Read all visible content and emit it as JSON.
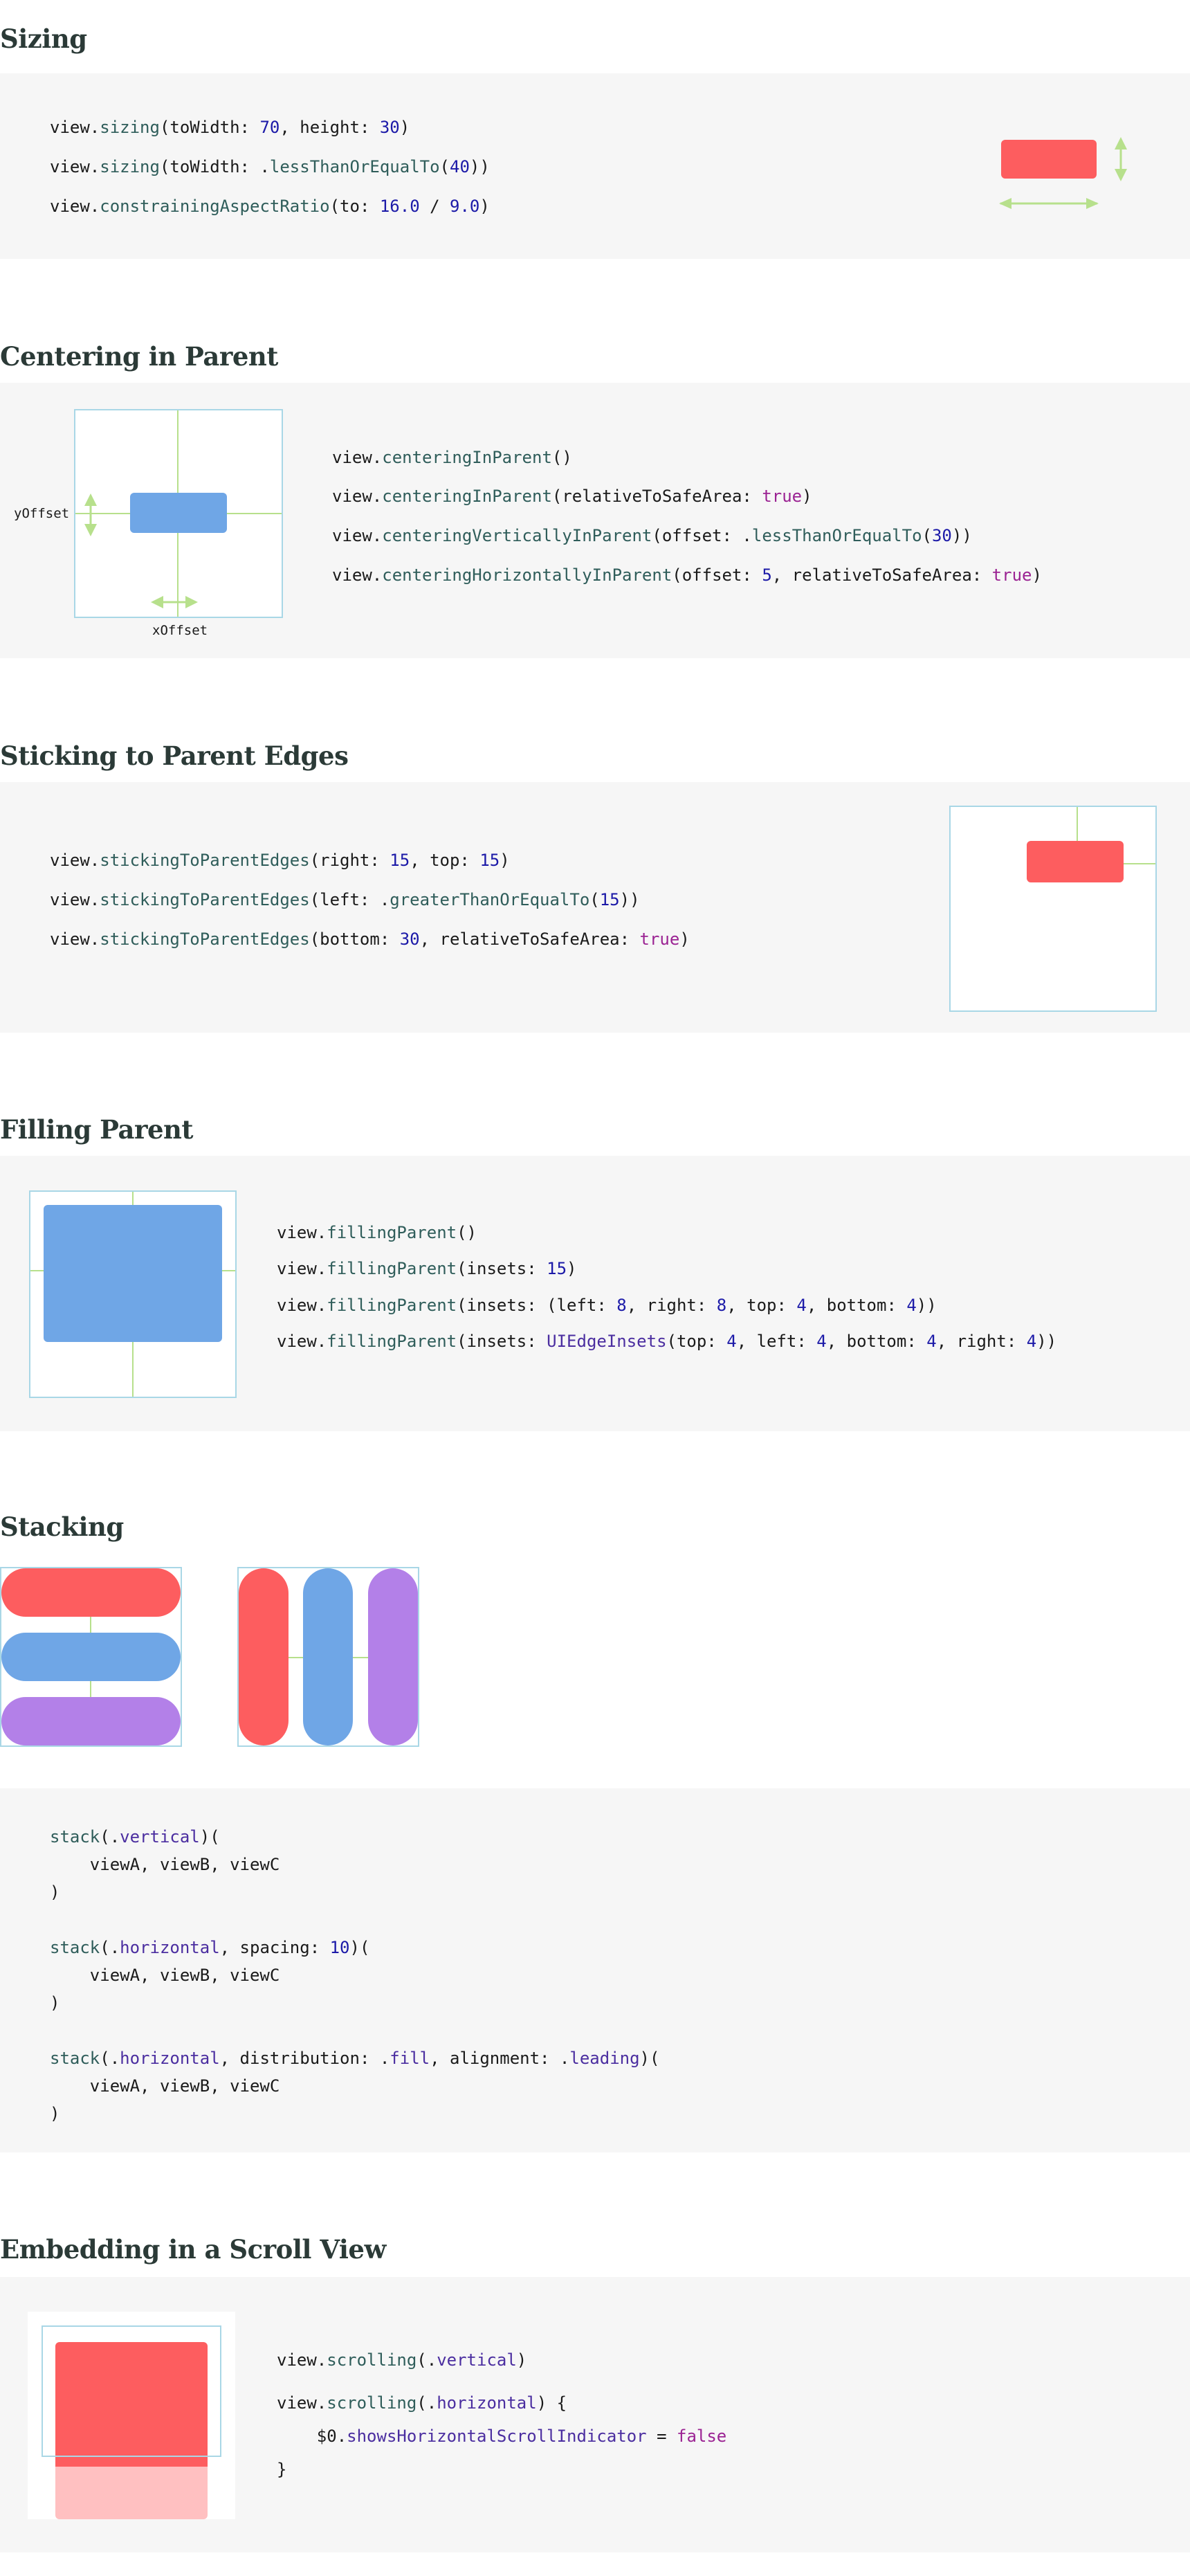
{
  "sections": {
    "sizing": {
      "title": "Sizing"
    },
    "centering": {
      "title": "Centering in Parent",
      "y_offset_label": "yOffset",
      "x_offset_label": "xOffset"
    },
    "sticking": {
      "title": "Sticking to Parent Edges"
    },
    "filling": {
      "title": "Filling Parent"
    },
    "stacking": {
      "title": "Stacking"
    },
    "scroll": {
      "title": "Embedding in a Scroll View"
    }
  },
  "code": {
    "sizing": [
      [
        [
          "view.",
          ""
        ],
        [
          "sizing",
          "t"
        ],
        [
          "(toWidth: ",
          ""
        ],
        [
          "70",
          "n"
        ],
        [
          ", height: ",
          ""
        ],
        [
          "30",
          "n"
        ],
        [
          ")",
          ""
        ]
      ],
      [
        [
          "view.",
          ""
        ],
        [
          "sizing",
          "t"
        ],
        [
          "(toWidth: .",
          ""
        ],
        [
          "lessThanOrEqualTo",
          "t"
        ],
        [
          "(",
          ""
        ],
        [
          "40",
          "n"
        ],
        [
          "))",
          ""
        ]
      ],
      [
        [
          "view.",
          ""
        ],
        [
          "constrainingAspectRatio",
          "t"
        ],
        [
          "(to: ",
          ""
        ],
        [
          "16.0",
          "n"
        ],
        [
          " / ",
          ""
        ],
        [
          "9.0",
          "n"
        ],
        [
          ")",
          ""
        ]
      ]
    ],
    "centering": [
      [
        [
          "view.",
          ""
        ],
        [
          "centeringInParent",
          "t"
        ],
        [
          "()",
          ""
        ]
      ],
      [
        [
          "view.",
          ""
        ],
        [
          "centeringInParent",
          "t"
        ],
        [
          "(relativeToSafeArea: ",
          ""
        ],
        [
          "true",
          "k"
        ],
        [
          ")",
          ""
        ]
      ],
      [
        [
          "view.",
          ""
        ],
        [
          "centeringVerticallyInParent",
          "t"
        ],
        [
          "(offset: .",
          ""
        ],
        [
          "lessThanOrEqualTo",
          "t"
        ],
        [
          "(",
          ""
        ],
        [
          "30",
          "n"
        ],
        [
          "))",
          ""
        ]
      ],
      [
        [
          "view.",
          ""
        ],
        [
          "centeringHorizontallyInParent",
          "t"
        ],
        [
          "(offset: ",
          ""
        ],
        [
          "5",
          "n"
        ],
        [
          ", relativeToSafeArea: ",
          ""
        ],
        [
          "true",
          "k"
        ],
        [
          ")",
          ""
        ]
      ]
    ],
    "sticking": [
      [
        [
          "view.",
          ""
        ],
        [
          "stickingToParentEdges",
          "t"
        ],
        [
          "(right: ",
          ""
        ],
        [
          "15",
          "n"
        ],
        [
          ", top: ",
          ""
        ],
        [
          "15",
          "n"
        ],
        [
          ")",
          ""
        ]
      ],
      [
        [
          "view.",
          ""
        ],
        [
          "stickingToParentEdges",
          "t"
        ],
        [
          "(left: .",
          ""
        ],
        [
          "greaterThanOrEqualTo",
          "t"
        ],
        [
          "(",
          ""
        ],
        [
          "15",
          "n"
        ],
        [
          "))",
          ""
        ]
      ],
      [
        [
          "view.",
          ""
        ],
        [
          "stickingToParentEdges",
          "t"
        ],
        [
          "(bottom: ",
          ""
        ],
        [
          "30",
          "n"
        ],
        [
          ", relativeToSafeArea: ",
          ""
        ],
        [
          "true",
          "k"
        ],
        [
          ")",
          ""
        ]
      ]
    ],
    "filling": [
      [
        [
          "view.",
          ""
        ],
        [
          "fillingParent",
          "t"
        ],
        [
          "()",
          ""
        ]
      ],
      [
        [
          "view.",
          ""
        ],
        [
          "fillingParent",
          "t"
        ],
        [
          "(insets: ",
          ""
        ],
        [
          "15",
          "n"
        ],
        [
          ")",
          ""
        ]
      ],
      [
        [
          "view.",
          ""
        ],
        [
          "fillingParent",
          "t"
        ],
        [
          "(insets: (left: ",
          ""
        ],
        [
          "8",
          "n"
        ],
        [
          ", right: ",
          ""
        ],
        [
          "8",
          "n"
        ],
        [
          ", top: ",
          ""
        ],
        [
          "4",
          "n"
        ],
        [
          ", bottom: ",
          ""
        ],
        [
          "4",
          "n"
        ],
        [
          "))",
          ""
        ]
      ],
      [
        [
          "view.",
          ""
        ],
        [
          "fillingParent",
          "t"
        ],
        [
          "(insets: ",
          ""
        ],
        [
          "UIEdgeInsets",
          "c"
        ],
        [
          "(top: ",
          ""
        ],
        [
          "4",
          "n"
        ],
        [
          ", left: ",
          ""
        ],
        [
          "4",
          "n"
        ],
        [
          ", bottom: ",
          ""
        ],
        [
          "4",
          "n"
        ],
        [
          ", right: ",
          ""
        ],
        [
          "4",
          "n"
        ],
        [
          "))",
          ""
        ]
      ]
    ],
    "stacking": [
      [
        [
          "stack",
          "t"
        ],
        [
          "(.",
          ""
        ],
        [
          "vertical",
          "c"
        ],
        [
          ")(",
          ""
        ]
      ],
      [
        [
          "    viewA, viewB, viewC",
          ""
        ]
      ],
      [
        [
          ")",
          ""
        ]
      ],
      [
        [
          "stack",
          "t"
        ],
        [
          "(.",
          ""
        ],
        [
          "horizontal",
          "c"
        ],
        [
          ", spacing: ",
          ""
        ],
        [
          "10",
          "n"
        ],
        [
          ")(",
          ""
        ]
      ],
      [
        [
          "    viewA, viewB, viewC",
          ""
        ]
      ],
      [
        [
          ")",
          ""
        ]
      ],
      [
        [
          "stack",
          "t"
        ],
        [
          "(.",
          ""
        ],
        [
          "horizontal",
          "c"
        ],
        [
          ", distribution: .",
          ""
        ],
        [
          "fill",
          "c"
        ],
        [
          ", alignment: .",
          ""
        ],
        [
          "leading",
          "c"
        ],
        [
          ")(",
          ""
        ]
      ],
      [
        [
          "    viewA, viewB, viewC",
          ""
        ]
      ],
      [
        [
          ")",
          ""
        ]
      ]
    ],
    "scroll": [
      [
        [
          "view.",
          ""
        ],
        [
          "scrolling",
          "t"
        ],
        [
          "(.",
          ""
        ],
        [
          "vertical",
          "c"
        ],
        [
          ")",
          ""
        ]
      ],
      [
        [
          "view.",
          ""
        ],
        [
          "scrolling",
          "t"
        ],
        [
          "(.",
          ""
        ],
        [
          "horizontal",
          "c"
        ],
        [
          ") {",
          ""
        ]
      ],
      [
        [
          "    $0.",
          ""
        ],
        [
          "showsHorizontalScrollIndicator",
          "c"
        ],
        [
          " = ",
          ""
        ],
        [
          "false",
          "k"
        ]
      ],
      [
        [
          "}",
          ""
        ]
      ]
    ]
  },
  "colors": {
    "heading": "#2b3a37",
    "panel": "#f6f6f6",
    "red": "#fd5d5f",
    "blue": "#6fa6e6",
    "purple": "#b380e8",
    "guide": "#b7e08c",
    "frame": "#a9d7e6",
    "light_red": "#ffc0c1"
  }
}
